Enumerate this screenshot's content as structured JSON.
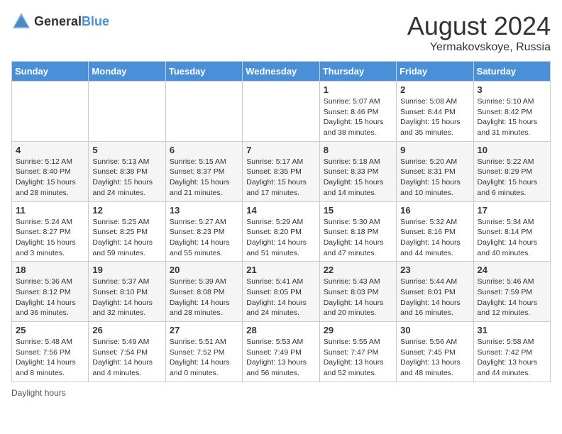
{
  "header": {
    "logo_general": "General",
    "logo_blue": "Blue",
    "month_year": "August 2024",
    "location": "Yermakovskoye, Russia"
  },
  "days_of_week": [
    "Sunday",
    "Monday",
    "Tuesday",
    "Wednesday",
    "Thursday",
    "Friday",
    "Saturday"
  ],
  "footer_note": "Daylight hours",
  "weeks": [
    [
      {
        "day": "",
        "sunrise": "",
        "sunset": "",
        "daylight": ""
      },
      {
        "day": "",
        "sunrise": "",
        "sunset": "",
        "daylight": ""
      },
      {
        "day": "",
        "sunrise": "",
        "sunset": "",
        "daylight": ""
      },
      {
        "day": "",
        "sunrise": "",
        "sunset": "",
        "daylight": ""
      },
      {
        "day": "1",
        "sunrise": "Sunrise: 5:07 AM",
        "sunset": "Sunset: 8:46 PM",
        "daylight": "Daylight: 15 hours and 38 minutes."
      },
      {
        "day": "2",
        "sunrise": "Sunrise: 5:08 AM",
        "sunset": "Sunset: 8:44 PM",
        "daylight": "Daylight: 15 hours and 35 minutes."
      },
      {
        "day": "3",
        "sunrise": "Sunrise: 5:10 AM",
        "sunset": "Sunset: 8:42 PM",
        "daylight": "Daylight: 15 hours and 31 minutes."
      }
    ],
    [
      {
        "day": "4",
        "sunrise": "Sunrise: 5:12 AM",
        "sunset": "Sunset: 8:40 PM",
        "daylight": "Daylight: 15 hours and 28 minutes."
      },
      {
        "day": "5",
        "sunrise": "Sunrise: 5:13 AM",
        "sunset": "Sunset: 8:38 PM",
        "daylight": "Daylight: 15 hours and 24 minutes."
      },
      {
        "day": "6",
        "sunrise": "Sunrise: 5:15 AM",
        "sunset": "Sunset: 8:37 PM",
        "daylight": "Daylight: 15 hours and 21 minutes."
      },
      {
        "day": "7",
        "sunrise": "Sunrise: 5:17 AM",
        "sunset": "Sunset: 8:35 PM",
        "daylight": "Daylight: 15 hours and 17 minutes."
      },
      {
        "day": "8",
        "sunrise": "Sunrise: 5:18 AM",
        "sunset": "Sunset: 8:33 PM",
        "daylight": "Daylight: 15 hours and 14 minutes."
      },
      {
        "day": "9",
        "sunrise": "Sunrise: 5:20 AM",
        "sunset": "Sunset: 8:31 PM",
        "daylight": "Daylight: 15 hours and 10 minutes."
      },
      {
        "day": "10",
        "sunrise": "Sunrise: 5:22 AM",
        "sunset": "Sunset: 8:29 PM",
        "daylight": "Daylight: 15 hours and 6 minutes."
      }
    ],
    [
      {
        "day": "11",
        "sunrise": "Sunrise: 5:24 AM",
        "sunset": "Sunset: 8:27 PM",
        "daylight": "Daylight: 15 hours and 3 minutes."
      },
      {
        "day": "12",
        "sunrise": "Sunrise: 5:25 AM",
        "sunset": "Sunset: 8:25 PM",
        "daylight": "Daylight: 14 hours and 59 minutes."
      },
      {
        "day": "13",
        "sunrise": "Sunrise: 5:27 AM",
        "sunset": "Sunset: 8:23 PM",
        "daylight": "Daylight: 14 hours and 55 minutes."
      },
      {
        "day": "14",
        "sunrise": "Sunrise: 5:29 AM",
        "sunset": "Sunset: 8:20 PM",
        "daylight": "Daylight: 14 hours and 51 minutes."
      },
      {
        "day": "15",
        "sunrise": "Sunrise: 5:30 AM",
        "sunset": "Sunset: 8:18 PM",
        "daylight": "Daylight: 14 hours and 47 minutes."
      },
      {
        "day": "16",
        "sunrise": "Sunrise: 5:32 AM",
        "sunset": "Sunset: 8:16 PM",
        "daylight": "Daylight: 14 hours and 44 minutes."
      },
      {
        "day": "17",
        "sunrise": "Sunrise: 5:34 AM",
        "sunset": "Sunset: 8:14 PM",
        "daylight": "Daylight: 14 hours and 40 minutes."
      }
    ],
    [
      {
        "day": "18",
        "sunrise": "Sunrise: 5:36 AM",
        "sunset": "Sunset: 8:12 PM",
        "daylight": "Daylight: 14 hours and 36 minutes."
      },
      {
        "day": "19",
        "sunrise": "Sunrise: 5:37 AM",
        "sunset": "Sunset: 8:10 PM",
        "daylight": "Daylight: 14 hours and 32 minutes."
      },
      {
        "day": "20",
        "sunrise": "Sunrise: 5:39 AM",
        "sunset": "Sunset: 8:08 PM",
        "daylight": "Daylight: 14 hours and 28 minutes."
      },
      {
        "day": "21",
        "sunrise": "Sunrise: 5:41 AM",
        "sunset": "Sunset: 8:05 PM",
        "daylight": "Daylight: 14 hours and 24 minutes."
      },
      {
        "day": "22",
        "sunrise": "Sunrise: 5:43 AM",
        "sunset": "Sunset: 8:03 PM",
        "daylight": "Daylight: 14 hours and 20 minutes."
      },
      {
        "day": "23",
        "sunrise": "Sunrise: 5:44 AM",
        "sunset": "Sunset: 8:01 PM",
        "daylight": "Daylight: 14 hours and 16 minutes."
      },
      {
        "day": "24",
        "sunrise": "Sunrise: 5:46 AM",
        "sunset": "Sunset: 7:59 PM",
        "daylight": "Daylight: 14 hours and 12 minutes."
      }
    ],
    [
      {
        "day": "25",
        "sunrise": "Sunrise: 5:48 AM",
        "sunset": "Sunset: 7:56 PM",
        "daylight": "Daylight: 14 hours and 8 minutes."
      },
      {
        "day": "26",
        "sunrise": "Sunrise: 5:49 AM",
        "sunset": "Sunset: 7:54 PM",
        "daylight": "Daylight: 14 hours and 4 minutes."
      },
      {
        "day": "27",
        "sunrise": "Sunrise: 5:51 AM",
        "sunset": "Sunset: 7:52 PM",
        "daylight": "Daylight: 14 hours and 0 minutes."
      },
      {
        "day": "28",
        "sunrise": "Sunrise: 5:53 AM",
        "sunset": "Sunset: 7:49 PM",
        "daylight": "Daylight: 13 hours and 56 minutes."
      },
      {
        "day": "29",
        "sunrise": "Sunrise: 5:55 AM",
        "sunset": "Sunset: 7:47 PM",
        "daylight": "Daylight: 13 hours and 52 minutes."
      },
      {
        "day": "30",
        "sunrise": "Sunrise: 5:56 AM",
        "sunset": "Sunset: 7:45 PM",
        "daylight": "Daylight: 13 hours and 48 minutes."
      },
      {
        "day": "31",
        "sunrise": "Sunrise: 5:58 AM",
        "sunset": "Sunset: 7:42 PM",
        "daylight": "Daylight: 13 hours and 44 minutes."
      }
    ]
  ]
}
